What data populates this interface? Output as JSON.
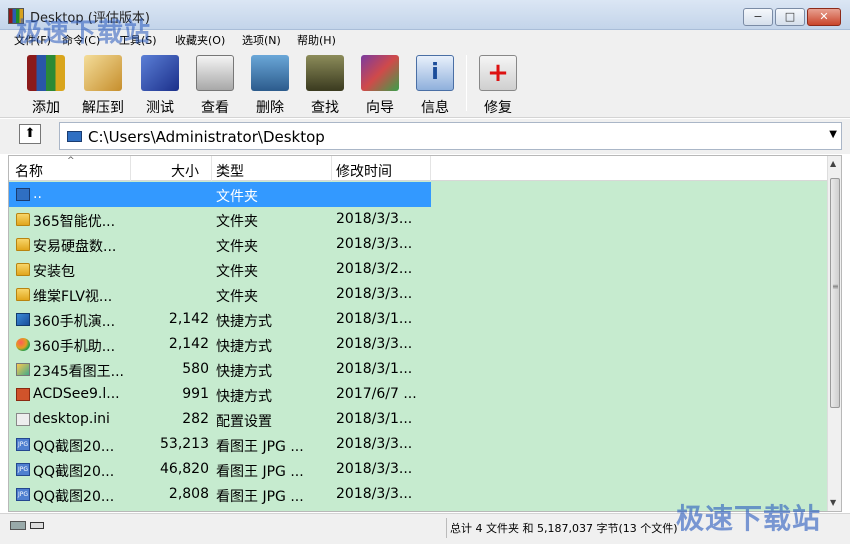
{
  "window": {
    "title": "Desktop (评估版本)",
    "min_glyph": "−",
    "max_glyph": "□",
    "close_glyph": "✕"
  },
  "watermark": "极速下载站",
  "menu": [
    "文件(F)",
    "命令(C)",
    "工具(S)",
    "收藏夹(O)",
    "选项(N)",
    "帮助(H)"
  ],
  "toolbar": [
    {
      "label": "添加",
      "icon": "add-archive-icon"
    },
    {
      "label": "解压到",
      "icon": "extract-icon"
    },
    {
      "label": "测试",
      "icon": "test-icon"
    },
    {
      "label": "查看",
      "icon": "view-icon"
    },
    {
      "label": "删除",
      "icon": "delete-icon"
    },
    {
      "label": "查找",
      "icon": "find-icon"
    },
    {
      "label": "向导",
      "icon": "wizard-icon"
    },
    {
      "label": "信息",
      "icon": "info-icon"
    },
    {
      "label": "修复",
      "icon": "repair-icon"
    }
  ],
  "address": {
    "path": "C:\\Users\\Administrator\\Desktop",
    "up_glyph": "⬆",
    "dropdown_glyph": "▼"
  },
  "columns": {
    "name": "名称",
    "size": "大小",
    "type": "类型",
    "modified": "修改时间",
    "sort_glyph": "^"
  },
  "files": [
    {
      "name": "..",
      "size": "",
      "type": "文件夹",
      "modified": "",
      "icon": "parent-folder-icon"
    },
    {
      "name": "365智能优...",
      "size": "",
      "type": "文件夹",
      "modified": "2018/3/3...",
      "icon": "folder-icon"
    },
    {
      "name": "安易硬盘数...",
      "size": "",
      "type": "文件夹",
      "modified": "2018/3/3...",
      "icon": "folder-icon"
    },
    {
      "name": "安装包",
      "size": "",
      "type": "文件夹",
      "modified": "2018/3/2...",
      "icon": "folder-icon"
    },
    {
      "name": "维棠FLV视...",
      "size": "",
      "type": "文件夹",
      "modified": "2018/3/3...",
      "icon": "folder-icon"
    },
    {
      "name": "360手机演...",
      "size": "2,142",
      "type": "快捷方式",
      "modified": "2018/3/1...",
      "icon": "shortcut-icon"
    },
    {
      "name": "360手机助...",
      "size": "2,142",
      "type": "快捷方式",
      "modified": "2018/3/3...",
      "icon": "shortcut-ball-icon"
    },
    {
      "name": "2345看图王...",
      "size": "580",
      "type": "快捷方式",
      "modified": "2018/3/1...",
      "icon": "image-viewer-icon"
    },
    {
      "name": "ACDSee9.l...",
      "size": "991",
      "type": "快捷方式",
      "modified": "2017/6/7 ...",
      "icon": "acdsee-icon"
    },
    {
      "name": "desktop.ini",
      "size": "282",
      "type": "配置设置",
      "modified": "2018/3/1...",
      "icon": "ini-file-icon"
    },
    {
      "name": "QQ截图20...",
      "size": "53,213",
      "type": "看图王 JPG ...",
      "modified": "2018/3/3...",
      "icon": "jpg-file-icon"
    },
    {
      "name": "QQ截图20...",
      "size": "46,820",
      "type": "看图王 JPG ...",
      "modified": "2018/3/3...",
      "icon": "jpg-file-icon"
    },
    {
      "name": "QQ截图20...",
      "size": "2,808",
      "type": "看图王 JPG ...",
      "modified": "2018/3/3...",
      "icon": "jpg-file-icon"
    }
  ],
  "jpg_badge": "JPG",
  "scrollbar": {
    "up_glyph": "▲",
    "down_glyph": "▼",
    "grip_glyph": "≡"
  },
  "status": "总计 4 文件夹 和 5,187,037 字节(13 个文件)"
}
